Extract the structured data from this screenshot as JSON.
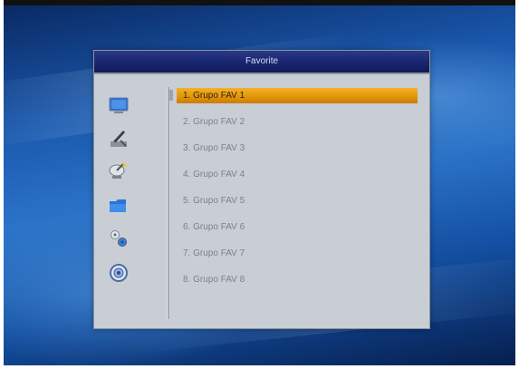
{
  "dialog": {
    "title": "Favorite"
  },
  "side_icons": [
    {
      "name": "tv-icon"
    },
    {
      "name": "installation-tools-icon"
    },
    {
      "name": "satellite-dish-icon"
    },
    {
      "name": "folder-icon"
    },
    {
      "name": "settings-gears-icon"
    },
    {
      "name": "info-icon"
    }
  ],
  "favorite_groups": [
    {
      "label": "1. Grupo FAV 1",
      "selected": true
    },
    {
      "label": "2. Grupo FAV 2",
      "selected": false
    },
    {
      "label": "3. Grupo FAV 3",
      "selected": false
    },
    {
      "label": "4. Grupo FAV 4",
      "selected": false
    },
    {
      "label": "5. Grupo FAV 5",
      "selected": false
    },
    {
      "label": "6. Grupo FAV 6",
      "selected": false
    },
    {
      "label": "7. Grupo FAV 7",
      "selected": false
    },
    {
      "label": "8. Grupo FAV 8",
      "selected": false
    }
  ],
  "colors": {
    "highlight": "#e39609",
    "header": "#1a2770",
    "panel": "#c9ced4"
  }
}
